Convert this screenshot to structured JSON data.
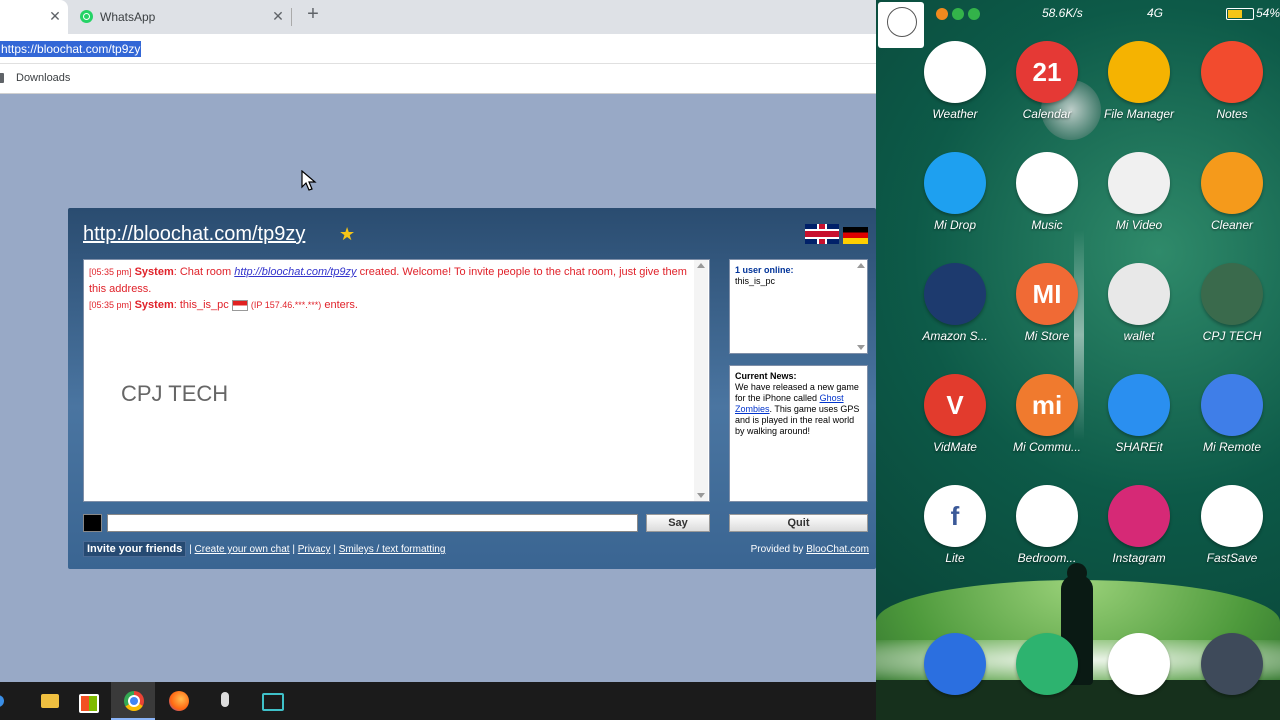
{
  "browser": {
    "tabs": [
      {
        "label": "",
        "close": "✕"
      },
      {
        "label": "WhatsApp",
        "close": "✕"
      }
    ],
    "new_tab": "+",
    "url": "https://bloochat.com/tp9zy",
    "bookmark_label": "Downloads"
  },
  "chat": {
    "room_url": "http://bloochat.com/tp9zy",
    "messages": [
      {
        "time": "[05:35 pm]",
        "sender": "System",
        "text_before": ": Chat room ",
        "link": "http://bloochat.com/tp9zy",
        "text_after": " created. Welcome! To invite people to the chat room, just give them this address."
      },
      {
        "time": "[05:35 pm]",
        "sender": "System",
        "text_before": ": this_is_pc ",
        "ip": "(IP 157.46.***.***)",
        "text_after": " enters."
      }
    ],
    "watermark": "CPJ TECH",
    "users_online": "1 user online:",
    "user_name": "this_is_pc",
    "news_title": "Current News:",
    "news_before": "We have released a new game for the iPhone called ",
    "news_link": "Ghost Zombies",
    "news_after": ". This game uses GPS and is played in the real world by walking around!",
    "say_label": "Say",
    "quit_label": "Quit",
    "invite_label": "Invite your friends",
    "sep": "|",
    "create_label": "Create your own chat",
    "privacy_label": "Privacy",
    "smileys_label": "Smileys / text formatting",
    "provided_by": "Provided by ",
    "provided_link": "BlooChat.com"
  },
  "phone": {
    "status": {
      "speed": "58.6K/s",
      "net": "4G",
      "battery_percent": "54%"
    },
    "apps": [
      {
        "label": "Weather",
        "color": "#ffffff"
      },
      {
        "label": "Calendar",
        "color": "#e53935",
        "glyph": "21"
      },
      {
        "label": "File Manager",
        "color": "#f5b301"
      },
      {
        "label": "Notes",
        "color": "#f24b2e"
      },
      {
        "label": "Mi Drop",
        "color": "#1ea0f0"
      },
      {
        "label": "Music",
        "color": "#ffffff"
      },
      {
        "label": "Mi Video",
        "color": "#f0f0f0"
      },
      {
        "label": "Cleaner",
        "color": "#f59a1b"
      },
      {
        "label": "Amazon S...",
        "color": "#1d3a6e"
      },
      {
        "label": "Mi Store",
        "color": "#f06a35",
        "glyph": "MI"
      },
      {
        "label": "wallet",
        "color": "#e8e8e8"
      },
      {
        "label": "CPJ TECH",
        "color": "#3a6a4c"
      },
      {
        "label": "VidMate",
        "color": "#e23b2d",
        "glyph": "V"
      },
      {
        "label": "Mi Commu...",
        "color": "#f07a2e",
        "glyph": "mi"
      },
      {
        "label": "SHAREit",
        "color": "#2a8ff0"
      },
      {
        "label": "Mi Remote",
        "color": "#3f7ee8"
      },
      {
        "label": "Lite",
        "color": "#ffffff",
        "glyph": "f"
      },
      {
        "label": "Bedroom...",
        "color": "#ffffff"
      },
      {
        "label": "Instagram",
        "color": "#d62976"
      },
      {
        "label": "FastSave",
        "color": "#ffffff"
      },
      {
        "label": "",
        "color": "#2b6fe0"
      },
      {
        "label": "",
        "color": "#2db36f"
      },
      {
        "label": "",
        "color": "#ffffff"
      },
      {
        "label": "",
        "color": "#3e4a5a"
      }
    ]
  },
  "taskbar": {
    "items": [
      "start",
      "file-explorer",
      "store",
      "chrome",
      "firefox",
      "microphone",
      "app"
    ]
  }
}
